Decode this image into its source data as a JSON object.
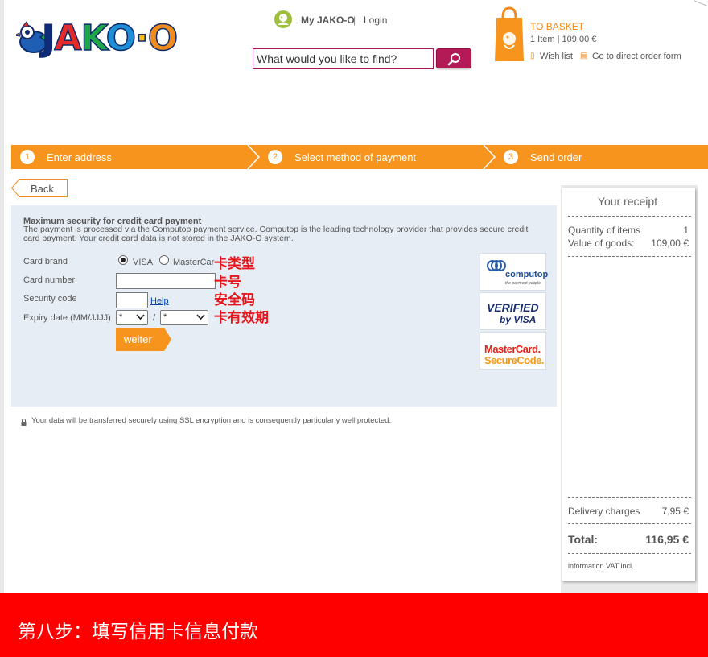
{
  "logo": {
    "text_j": "J",
    "text_a": "A",
    "text_k": "K",
    "text_o": "O",
    "text_dot": "·",
    "text_o2": "O",
    "alt": "JAKO-O"
  },
  "header": {
    "my_account": "My JAKO-O",
    "separator": "|",
    "login": "Login",
    "search_placeholder": "What would you like to find?",
    "basket_link": "TO BASKET",
    "basket_summary": "1 Item | 109,00 €",
    "wish_list": "Wish list",
    "direct_order": "Go to direct order form"
  },
  "steps": [
    {
      "num": "1",
      "label": "Enter address"
    },
    {
      "num": "2",
      "label": "Select method of payment"
    },
    {
      "num": "3",
      "label": "Send order"
    }
  ],
  "back_label": "Back",
  "payment": {
    "heading": "Maximum security for credit card payment",
    "description": "The payment is processed via the Computop payment service. Computop is the leading technology provider that provides secure credit card payment. Your credit card data is not stored in the JAKO-O system.",
    "card_brand_label": "Card brand",
    "brand_options": [
      "VISA",
      "MasterCard"
    ],
    "selected_brand": "VISA",
    "card_number_label": "Card number",
    "card_number_value": "",
    "security_code_label": "Security code",
    "security_code_value": "",
    "help_link": "Help",
    "expiry_label": "Expiry date (MM/JJJJ)",
    "expiry_month": "*",
    "expiry_year": "*",
    "expiry_separator": "/",
    "submit_label": "weiter"
  },
  "annotations": [
    "卡类型",
    "卡号",
    "安全码",
    "卡有效期"
  ],
  "payment_logos": {
    "computop": "computop",
    "computop_tagline": "the payment people",
    "verified": "VERIFIED",
    "by_visa": "by VISA",
    "mastercard": "MasterCard.",
    "securecode": "SecureCode."
  },
  "ssl_note": "Your data will be transferred securely using SSL encryption and is consequently particularly well protected.",
  "receipt": {
    "title": "Your receipt",
    "quantity_label": "Quantity of items",
    "quantity_value": "1",
    "goods_label": "Value of goods:",
    "goods_value": "109,00 €",
    "delivery_label": "Delivery charges",
    "delivery_value": "7,95 €",
    "total_label": "Total:",
    "total_value": "116,95 €",
    "vat_note": "information VAT incl."
  },
  "banner_text": "第八步：填写信用卡信息付款",
  "colors": {
    "accent_orange": "#f7941d",
    "search_button": "#b31a56",
    "panel_bg": "#e7edf5",
    "banner_red": "#fe0000",
    "annotation_red": "#e8141b"
  }
}
